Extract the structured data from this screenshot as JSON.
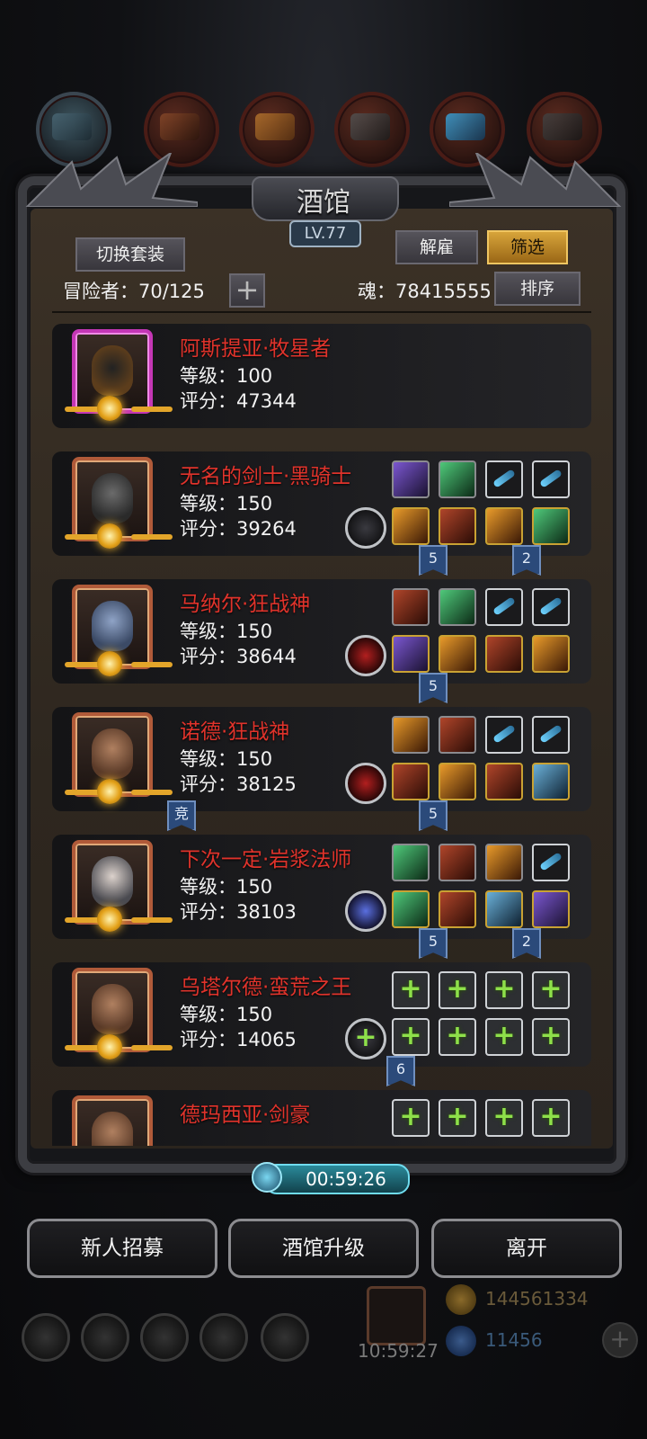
{
  "window": {
    "title": "酒馆",
    "level": "LV.77"
  },
  "header": {
    "switch_outfit_label": "切换套装",
    "dismiss_label": "解雇",
    "filter_label": "筛选",
    "sort_label": "排序",
    "adventurers_label": "冒险者：70/125",
    "soul_label": "魂：78415555",
    "add_label": "+"
  },
  "heroes": [
    {
      "name": "阿斯提亚·牧星者",
      "level": "等级：100",
      "score": "评分：47344"
    },
    {
      "name": "无名的剑士·黑骑士",
      "level": "等级：150",
      "score": "评分：39264"
    },
    {
      "name": "马纳尔·狂战神",
      "level": "等级：150",
      "score": "评分：38644"
    },
    {
      "name": "诺德·狂战神",
      "level": "等级：150",
      "score": "评分：38125"
    },
    {
      "name": "下次一定·岩浆法师",
      "level": "等级：150",
      "score": "评分：38103"
    },
    {
      "name": "乌塔尔德·蛮荒之王",
      "level": "等级：150",
      "score": "评分：14065"
    },
    {
      "name": "德玛西亚·剑豪"
    }
  ],
  "flags": {
    "f1a": "5",
    "f1b": "2",
    "f2a": "5",
    "f3a": "竞",
    "f3b": "5",
    "f4a": "5",
    "f4b": "2",
    "f5a": "6"
  },
  "timer": "00:59:26",
  "footer": {
    "recruit_label": "新人招募",
    "upgrade_label": "酒馆升级",
    "leave_label": "离开",
    "gold": "144561334",
    "gems": "11456",
    "gift_timer": "10:59:27"
  }
}
